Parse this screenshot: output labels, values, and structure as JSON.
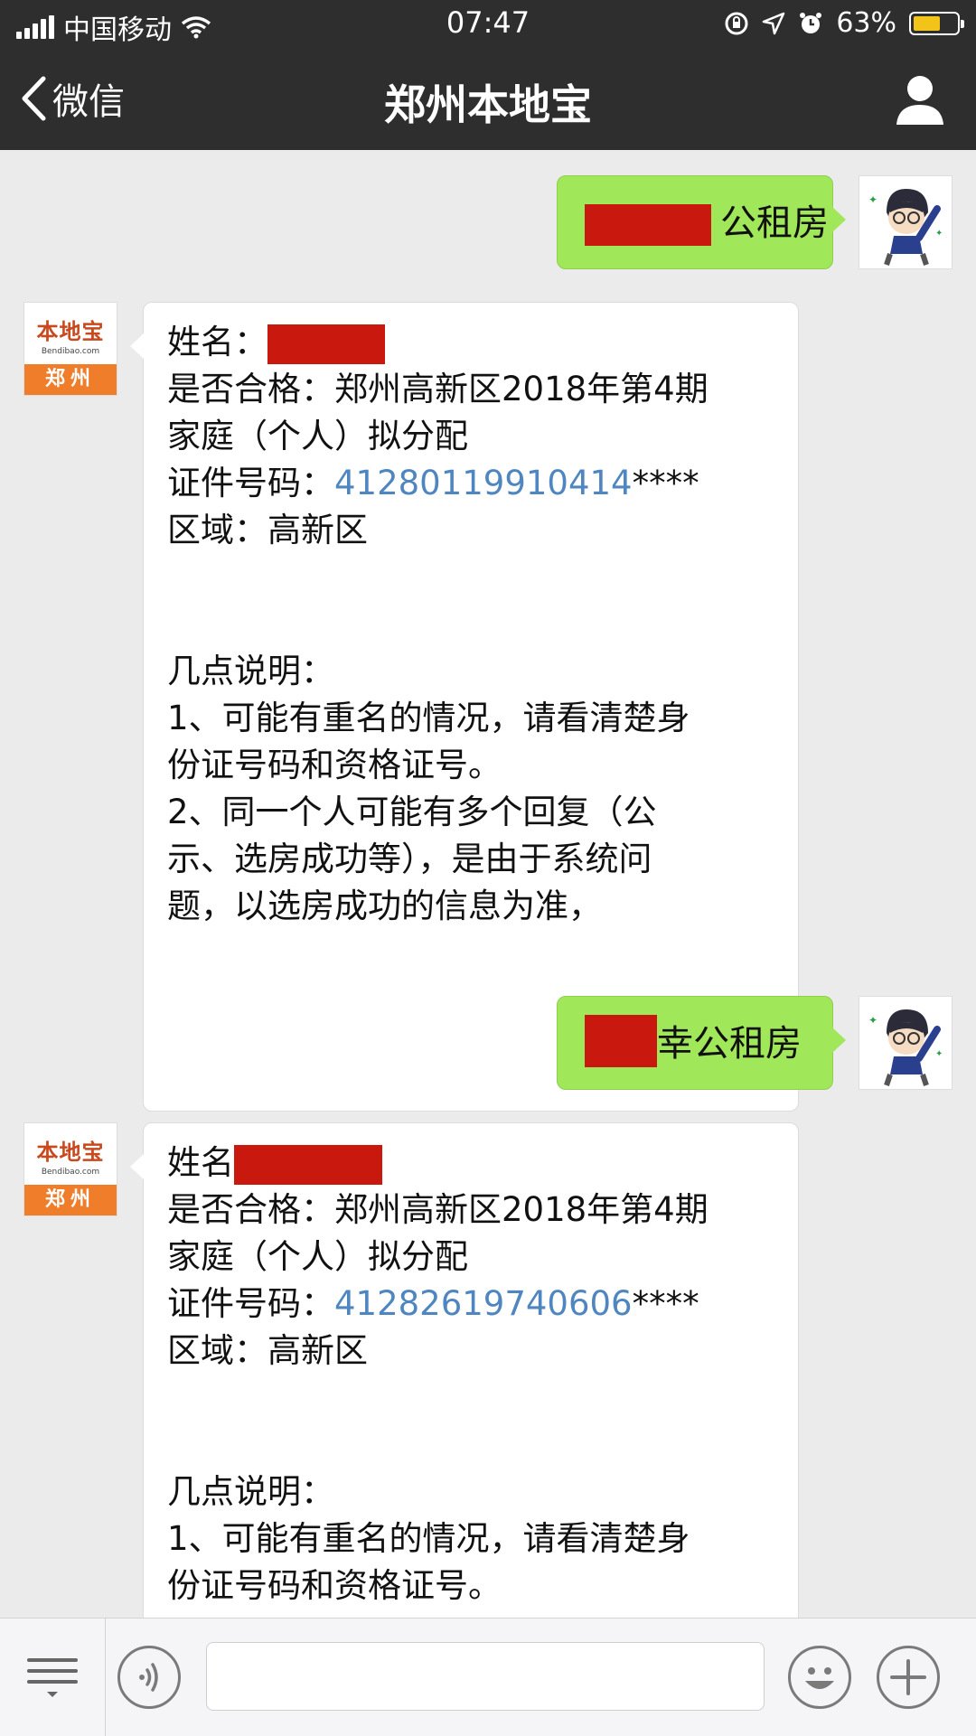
{
  "status_bar": {
    "carrier": "中国移动",
    "time": "07:47",
    "battery_percent": "63%",
    "battery_level": 0.63,
    "colors": {
      "battery_fill": "#f2c319"
    }
  },
  "nav": {
    "back_label": "微信",
    "title": "郑州本地宝",
    "icons": {
      "back": "chevron-left-icon",
      "user": "person-icon"
    }
  },
  "bot": {
    "logo_text": "本地宝",
    "logo_url": "Bendibao.com",
    "city": "郑州"
  },
  "messages": [
    {
      "direction": "out",
      "visible_text": "公租房",
      "redacted": true
    },
    {
      "direction": "in",
      "name_label": "姓名：",
      "qualify_line": "是否合格：郑州高新区2018年第4期",
      "qualify_line2": "家庭（个人）拟分配",
      "id_label": "证件号码：",
      "id_number": "41280119910414",
      "id_mask": "****",
      "area_line": "区域：高新区",
      "notes_title": "几点说明：",
      "note1_a": "1、可能有重名的情况，请看清楚身",
      "note1_b": "份证号码和资格证号。",
      "note2_a": "2、同一个人可能有多个回复（公",
      "note2_b": "示、选房成功等），是由于系统问",
      "note2_c": "题，以选房成功的信息为准，"
    },
    {
      "direction": "out",
      "visible_text": "幸公租房",
      "redacted": true
    },
    {
      "direction": "in",
      "name_label": "姓名",
      "qualify_line": "是否合格：郑州高新区2018年第4期",
      "qualify_line2": "家庭（个人）拟分配",
      "id_label": "证件号码：",
      "id_number": "41282619740606",
      "id_mask": "****",
      "area_line": "区域：高新区",
      "notes_title": "几点说明：",
      "note1_a": "1、可能有重名的情况，请看清楚身",
      "note1_b": "份证号码和资格证号。"
    }
  ],
  "input_bar": {
    "icons": {
      "menu": "menu-list-icon",
      "voice": "voice-icon",
      "emoji": "emoji-icon",
      "plus": "plus-icon"
    }
  },
  "colors": {
    "chat_background": "#ebebeb",
    "outgoing_bubble": "#a0e75a",
    "incoming_bubble": "#ffffff",
    "link": "#4f86c0",
    "redaction": "#c9190f",
    "header": "#2e2e2e"
  }
}
